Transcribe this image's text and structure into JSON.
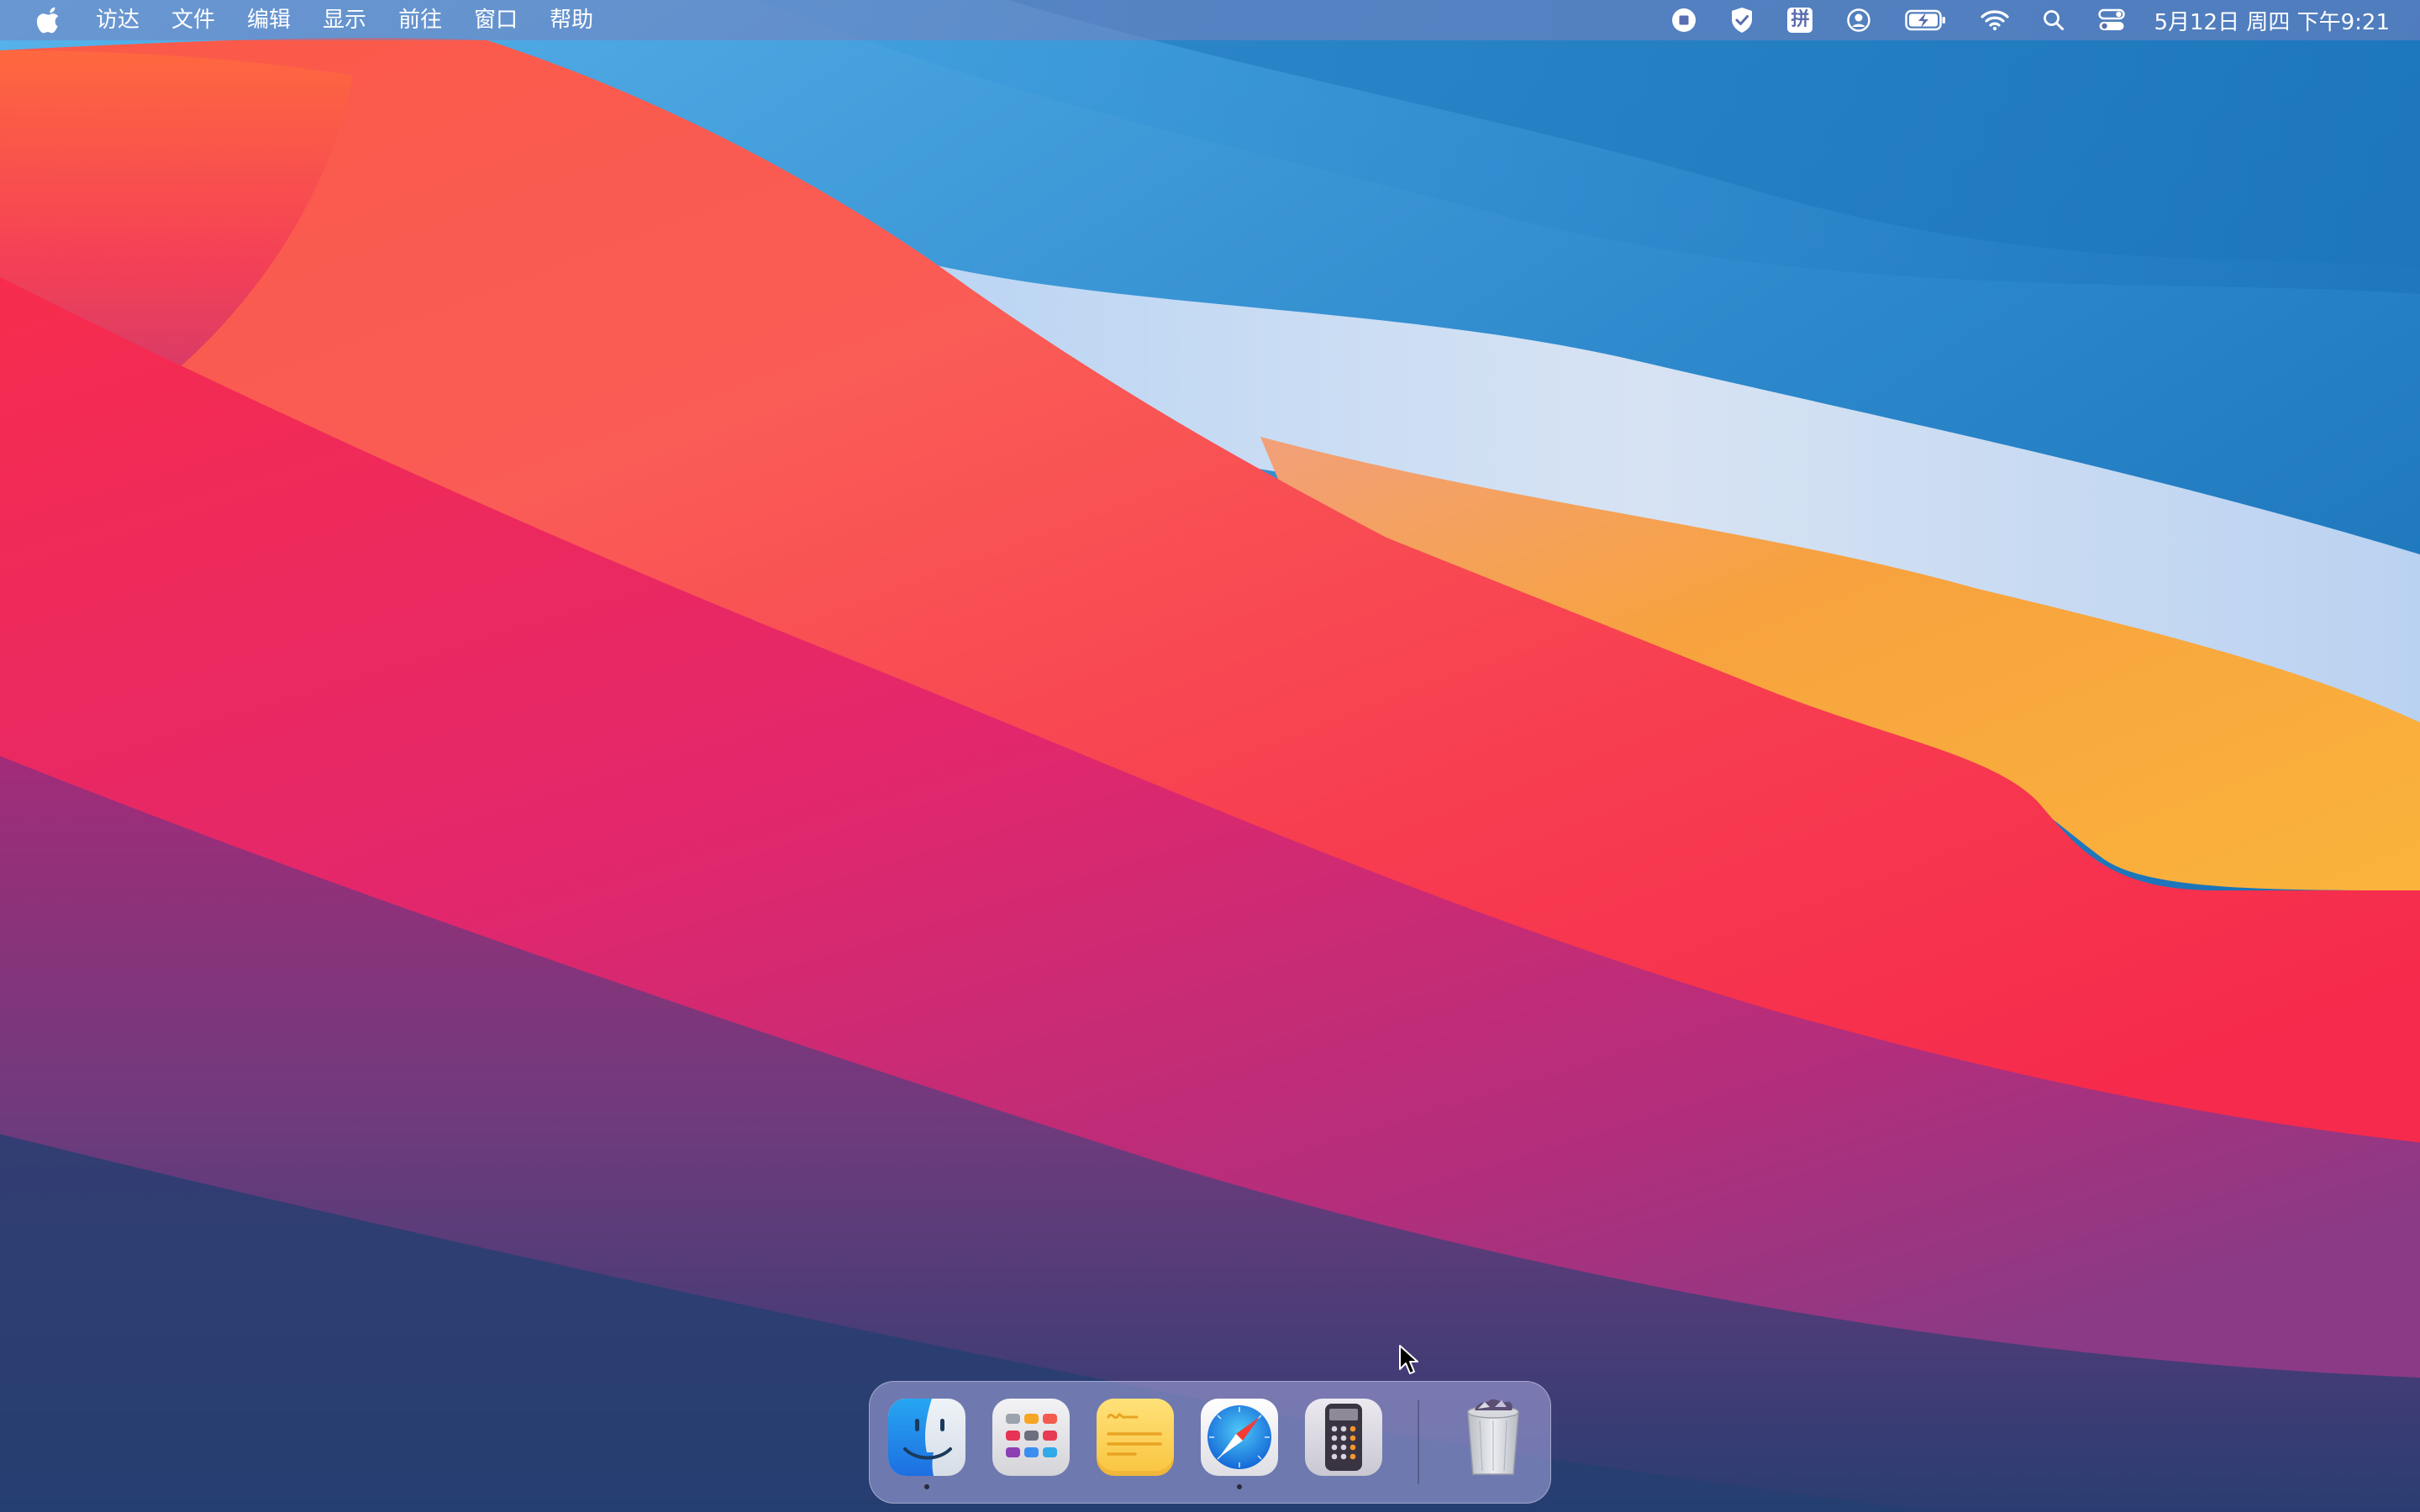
{
  "menubar": {
    "apple_icon": "apple-logo-icon",
    "items": [
      "访达",
      "文件",
      "编辑",
      "显示",
      "前往",
      "窗口",
      "帮助"
    ],
    "status_icons": [
      "screen-record-stop-icon",
      "vpn-shield-icon",
      "input-method-icon",
      "user-account-icon",
      "battery-charging-icon",
      "wifi-icon",
      "spotlight-search-icon",
      "control-center-icon"
    ],
    "input_method_label": "拼",
    "clock": "5月12日 周四 下午9:21"
  },
  "dock": {
    "apps": [
      {
        "name": "Finder",
        "icon": "finder-icon",
        "running": true
      },
      {
        "name": "Launchpad",
        "icon": "launchpad-icon",
        "running": false
      },
      {
        "name": "Stickies",
        "icon": "stickies-icon",
        "running": false
      },
      {
        "name": "Safari",
        "icon": "safari-icon",
        "running": true
      },
      {
        "name": "Calculator",
        "icon": "calculator-icon",
        "running": false
      }
    ],
    "trash": {
      "name": "Trash",
      "icon": "trash-full-icon"
    }
  },
  "colors": {
    "wallpaper_red": "#f4314f",
    "wallpaper_orange": "#f7a43d",
    "wallpaper_blue": "#2a82c8",
    "wallpaper_light": "#cfe0f4",
    "wallpaper_purple": "#6d3b7c"
  }
}
